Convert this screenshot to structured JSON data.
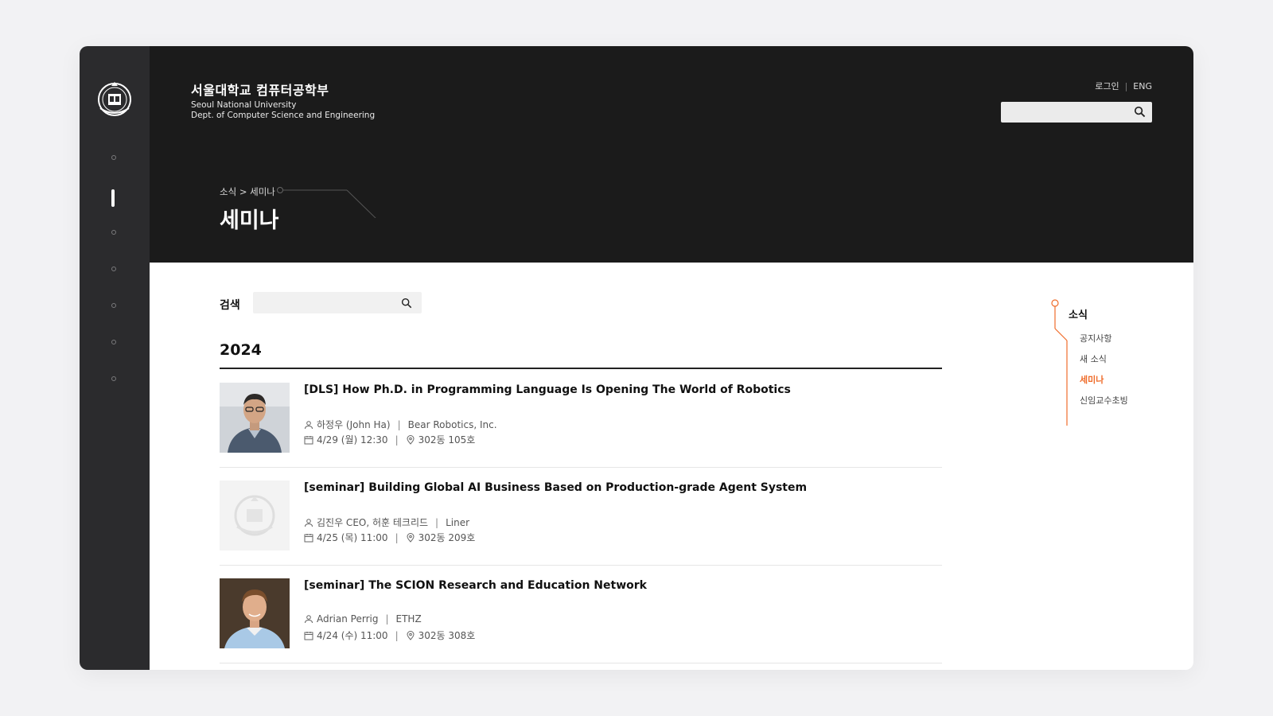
{
  "brand": {
    "name_ko": "서울대학교 컴퓨터공학부",
    "name_en_line1": "Seoul National University",
    "name_en_line2": "Dept. of Computer Science and Engineering"
  },
  "top_links": {
    "login": "로그인",
    "language": "ENG"
  },
  "breadcrumb": {
    "parent": "소식",
    "separator": ">",
    "current": "세미나"
  },
  "page_title": "세미나",
  "search": {
    "label": "검색",
    "placeholder": ""
  },
  "year_heading": "2024",
  "seminars": [
    {
      "title": "[DLS] How Ph.D. in Programming Language Is Opening The World of Robotics",
      "speaker": "하정우 (John Ha)",
      "affiliation": "Bear Robotics, Inc.",
      "datetime": "4/29 (월) 12:30",
      "location": "302동 105호"
    },
    {
      "title": "[seminar] Building Global AI Business Based on Production-grade Agent System",
      "speaker": "김진우 CEO, 허훈 테크리드",
      "affiliation": "Liner",
      "datetime": "4/25 (목) 11:00",
      "location": "302동 209호"
    },
    {
      "title": "[seminar] The SCION Research and Education Network",
      "speaker": "Adrian Perrig",
      "affiliation": "ETHZ",
      "datetime": "4/24 (수) 11:00",
      "location": "302동 308호"
    }
  ],
  "side_nav": {
    "title": "소식",
    "items": [
      "공지사항",
      "새 소식",
      "세미나",
      "신임교수초빙"
    ],
    "active": "세미나",
    "accent_color": "#ef6c2a"
  },
  "colors": {
    "header_bg": "#1b1b1b",
    "rail_bg": "#2b2b2d",
    "accent": "#ef6c2a"
  }
}
